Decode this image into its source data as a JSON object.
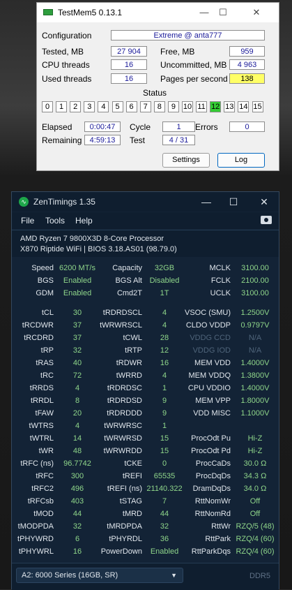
{
  "testmem": {
    "title": "TestMem5  0.13.1",
    "window_controls": [
      "—",
      "☐",
      "✕"
    ],
    "configuration_label": "Configuration",
    "configuration_value": "Extreme @ anta777",
    "tested_label": "Tested, MB",
    "tested_value": "27 904",
    "free_label": "Free, MB",
    "free_value": "959",
    "cpu_threads_label": "CPU threads",
    "cpu_threads_value": "16",
    "uncommitted_label": "Uncommitted, MB",
    "uncommitted_value": "4 963",
    "used_threads_label": "Used threads",
    "used_threads_value": "16",
    "pages_label": "Pages per second",
    "pages_value": "138",
    "status_label": "Status",
    "threads": [
      "0",
      "1",
      "2",
      "3",
      "4",
      "5",
      "6",
      "7",
      "8",
      "9",
      "10",
      "11",
      "12",
      "13",
      "14",
      "15"
    ],
    "active_thread": "12",
    "elapsed_label": "Elapsed",
    "elapsed_value": "0:00:47",
    "cycle_label": "Cycle",
    "cycle_value": "1",
    "errors_label": "Errors",
    "errors_value": "0",
    "remaining_label": "Remaining",
    "remaining_value": "4:59:13",
    "test_label": "Test",
    "test_value": "4 / 31",
    "settings_label": "Settings",
    "log_label": "Log",
    "accent_active": "#33cc33",
    "accent_pages": "#ffff66"
  },
  "zen": {
    "title": "ZenTimings 1.35",
    "window_controls": [
      "—",
      "☐",
      "✕"
    ],
    "menu": [
      "File",
      "Tools",
      "Help"
    ],
    "camera_icon": "camera-icon",
    "cpu": "AMD Ryzen 7 9800X3D 8-Core Processor",
    "board": "X870 Riptide WiFi | BIOS 3.18.AS01 (98.79.0)",
    "top_rows": [
      [
        "Speed",
        "6200 MT/s",
        "Capacity",
        "32GB",
        "MCLK",
        "3100.00"
      ],
      [
        "BGS",
        "Enabled",
        "BGS Alt",
        "Disabled",
        "FCLK",
        "2100.00"
      ],
      [
        "GDM",
        "Enabled",
        "Cmd2T",
        "1T",
        "UCLK",
        "3100.00"
      ]
    ],
    "rows": [
      [
        "tCL",
        "30",
        "tRDRDSCL",
        "4",
        "VSOC (SMU)",
        "1.2500V"
      ],
      [
        "tRCDWR",
        "37",
        "tWRWRSCL",
        "4",
        "CLDO VDDP",
        "0.9797V"
      ],
      [
        "tRCDRD",
        "37",
        "tCWL",
        "28",
        "VDDG CCD",
        "N/A"
      ],
      [
        "tRP",
        "32",
        "tRTP",
        "12",
        "VDDG IOD",
        "N/A"
      ],
      [
        "tRAS",
        "40",
        "tRDWR",
        "16",
        "MEM VDD",
        "1.4000V"
      ],
      [
        "tRC",
        "72",
        "tWRRD",
        "4",
        "MEM VDDQ",
        "1.3800V"
      ],
      [
        "tRRDS",
        "4",
        "tRDRDSC",
        "1",
        "CPU VDDIO",
        "1.4000V"
      ],
      [
        "tRRDL",
        "8",
        "tRDRDSD",
        "9",
        "MEM VPP",
        "1.8000V"
      ],
      [
        "tFAW",
        "20",
        "tRDRDDD",
        "9",
        "VDD MISC",
        "1.1000V"
      ],
      [
        "tWTRS",
        "4",
        "tWRWRSC",
        "1",
        "",
        ""
      ],
      [
        "tWTRL",
        "14",
        "tWRWRSD",
        "15",
        "ProcOdt Pu",
        "Hi-Z"
      ],
      [
        "tWR",
        "48",
        "tWRWRDD",
        "15",
        "ProcOdt Pd",
        "Hi-Z"
      ],
      [
        "tRFC (ns)",
        "96.7742",
        "tCKE",
        "0",
        "ProcCaDs",
        "30.0 Ω"
      ],
      [
        "tRFC",
        "300",
        "tREFI",
        "65535",
        "ProcDqDs",
        "34.3 Ω"
      ],
      [
        "tRFC2",
        "496",
        "tREFI (ns)",
        "21140.322",
        "DramDqDs",
        "34.0 Ω"
      ],
      [
        "tRFCsb",
        "403",
        "tSTAG",
        "7",
        "RttNomWr",
        "Off"
      ],
      [
        "tMOD",
        "44",
        "tMRD",
        "44",
        "RttNomRd",
        "Off"
      ],
      [
        "tMODPDA",
        "32",
        "tMRDPDA",
        "32",
        "RttWr",
        "RZQ/5 (48)"
      ],
      [
        "tPHYWRD",
        "6",
        "tPHYRDL",
        "36",
        "RttPark",
        "RZQ/4 (60)"
      ],
      [
        "tPHYWRL",
        "16",
        "PowerDown",
        "Enabled",
        "RttParkDqs",
        "RZQ/4 (60)"
      ]
    ],
    "dimmed_keys": [
      "VDDG CCD",
      "VDDG IOD"
    ],
    "module_select": "A2: 6000 Series (16GB, SR)",
    "memory_type": "DDR5",
    "accent_value": "#8fd68a"
  }
}
